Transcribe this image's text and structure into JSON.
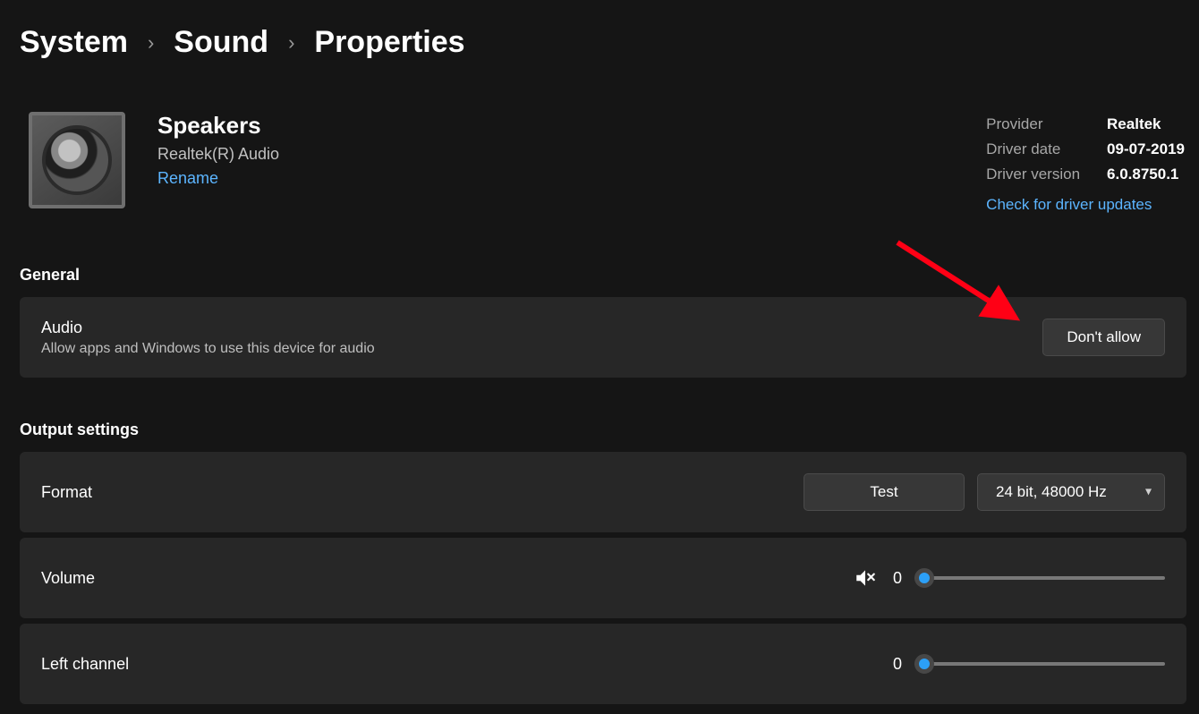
{
  "breadcrumb": {
    "system": "System",
    "sound": "Sound",
    "properties": "Properties"
  },
  "device": {
    "name": "Speakers",
    "subtitle": "Realtek(R) Audio",
    "rename": "Rename"
  },
  "driver": {
    "provider_label": "Provider",
    "provider_value": "Realtek",
    "date_label": "Driver date",
    "date_value": "09-07-2019",
    "version_label": "Driver version",
    "version_value": "6.0.8750.1",
    "check_updates": "Check for driver updates"
  },
  "sections": {
    "general": "General",
    "output": "Output settings"
  },
  "general": {
    "audio_title": "Audio",
    "audio_desc": "Allow apps and Windows to use this device for audio",
    "dont_allow": "Don't allow"
  },
  "output": {
    "format_label": "Format",
    "test_label": "Test",
    "format_value": "24 bit, 48000 Hz",
    "volume_label": "Volume",
    "volume_value": "0",
    "left_channel_label": "Left channel",
    "left_channel_value": "0"
  }
}
